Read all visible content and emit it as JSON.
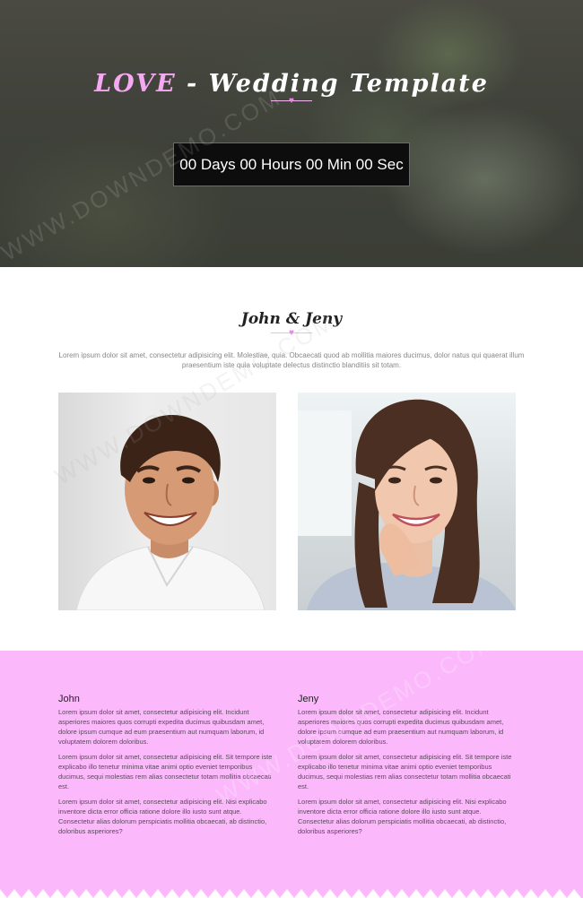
{
  "hero": {
    "title_accent": "LOVE",
    "title_rest": " - Wedding Template",
    "countdown": "00 Days 00 Hours 00 Min 00 Sec"
  },
  "couple": {
    "title": "John & Jeny",
    "intro": "Lorem ipsum dolor sit amet, consectetur adipisicing elit. Molestiae, quia. Obcaecati quod ab mollitia maiores ducimus, dolor natus qui quaerat illum praesentium iste quia voluptate delectus distinctio blanditiis sit totam."
  },
  "bios": [
    {
      "name": "John",
      "paragraphs": [
        "Lorem ipsum dolor sit amet, consectetur adipisicing elit. Incidunt asperiores maiores quos corrupti expedita ducimus quibusdam amet, dolore ipsum cumque ad eum praesentium aut numquam laborum, id voluptatem dolorem doloribus.",
        "Lorem ipsum dolor sit amet, consectetur adipisicing elit. Sit tempore iste explicabo illo tenetur minima vitae animi optio eveniet temporibus ducimus, sequi molestias rem alias consectetur totam mollitia obcaecati est.",
        "Lorem ipsum dolor sit amet, consectetur adipisicing elit. Nisi explicabo inventore dicta error officia ratione dolore illo iusto sunt atque. Consectetur alias dolorum perspiciatis mollitia obcaecati, ab distinctio, doloribus asperiores?"
      ]
    },
    {
      "name": "Jeny",
      "paragraphs": [
        "Lorem ipsum dolor sit amet, consectetur adipisicing elit. Incidunt asperiores maiores quos corrupti expedita ducimus quibusdam amet, dolore ipsum cumque ad eum praesentium aut numquam laborum, id voluptatem dolorem doloribus.",
        "Lorem ipsum dolor sit amet, consectetur adipisicing elit. Sit tempore iste explicabo illo tenetur minima vitae animi optio eveniet temporibus ducimus, sequi molestias rem alias consectetur totam mollitia obcaecati est.",
        "Lorem ipsum dolor sit amet, consectetur adipisicing elit. Nisi explicabo inventore dicta error officia ratione dolore illo iusto sunt atque. Consectetur alias dolorum perspiciatis mollitia obcaecati, ab distinctio, doloribus asperiores?"
      ]
    }
  ],
  "watermark": "WWW.DOWNDEMO.COM",
  "colors": {
    "accent_pink": "#f6a9f3",
    "section_pink": "#fbb8fb",
    "heart": "#f084e8"
  },
  "icons": {
    "divider_heart": "heart-icon"
  }
}
